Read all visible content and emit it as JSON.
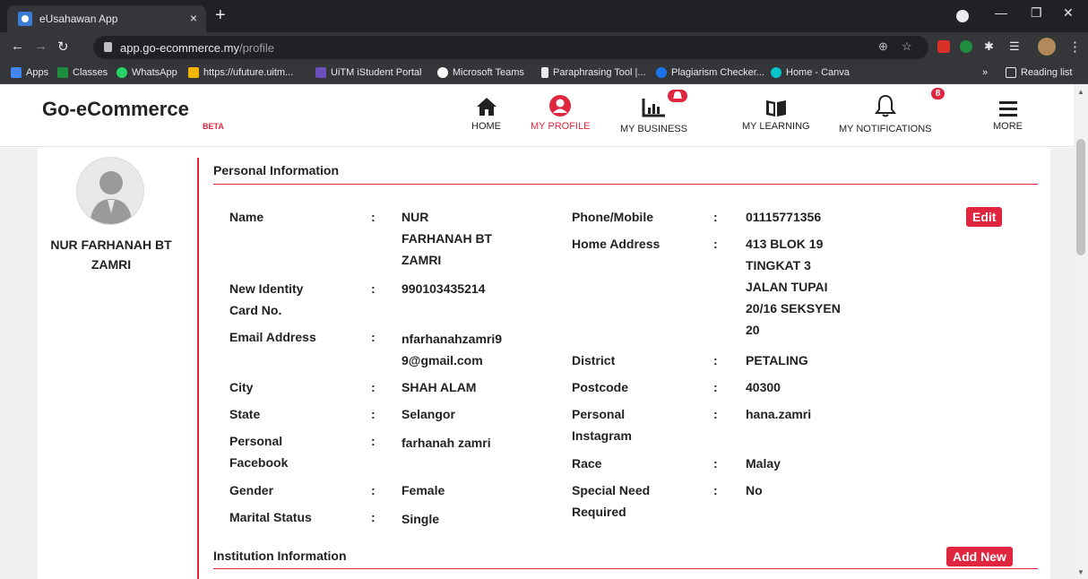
{
  "browser": {
    "tab_title": "eUsahawan App",
    "tab_close": "×",
    "new_tab": "+",
    "url_host": "app.go-ecommerce.my",
    "url_path": "/profile",
    "bookmarks": [
      {
        "label": "Apps",
        "color": "#4285f4"
      },
      {
        "label": "Classes",
        "color": "#1e8e3e"
      },
      {
        "label": "WhatsApp",
        "color": "#25d366"
      },
      {
        "label": "https://ufuture.uitm...",
        "color": "#f4b400"
      },
      {
        "label": "UiTM iStudent Portal",
        "color": "#6b4fbb"
      },
      {
        "label": "Microsoft Teams",
        "color": "#ffffff"
      },
      {
        "label": "Paraphrasing Tool |...",
        "color": "#ffffff"
      },
      {
        "label": "Plagiarism Checker...",
        "color": "#1a73e8"
      },
      {
        "label": "Home - Canva",
        "color": "#00c4cc"
      }
    ],
    "bookmarks_more": "»",
    "reading_list": "Reading list"
  },
  "header": {
    "logo": "Go-eCommerce",
    "beta": "BETA",
    "nav": [
      {
        "label": "HOME",
        "icon": "home-icon"
      },
      {
        "label": "MY PROFILE",
        "icon": "user-icon"
      },
      {
        "label": "MY BUSINESS",
        "icon": "chart-icon",
        "badge": ""
      },
      {
        "label": "MY LEARNING",
        "icon": "book-icon"
      },
      {
        "label": "MY NOTIFICATIONS",
        "icon": "bell-icon",
        "badge": "8"
      },
      {
        "label": "MORE",
        "icon": "menu-icon"
      }
    ],
    "accent_color": "#e0263f"
  },
  "profile": {
    "name_line1": "NUR FARHANAH BT",
    "name_line2": "ZAMRI"
  },
  "personal": {
    "title": "Personal Information",
    "edit_label": "Edit",
    "colon": ":",
    "left": {
      "name_label": "Name",
      "name_value": [
        "NUR",
        "FARHANAH BT",
        "ZAMRI"
      ],
      "ic_label": [
        "New Identity",
        "Card No."
      ],
      "ic_value": "990103435214",
      "email_label": "Email Address",
      "email_value": [
        "nfarhanahzamri9",
        "9@gmail.com"
      ],
      "city_label": "City",
      "city_value": "SHAH ALAM",
      "state_label": "State",
      "state_value": "Selangor",
      "fb_label": [
        "Personal",
        "Facebook"
      ],
      "fb_value": "farhanah zamri",
      "gender_label": "Gender",
      "gender_value": "Female",
      "marital_label": "Marital Status",
      "marital_value": "Single"
    },
    "right": {
      "phone_label": "Phone/Mobile",
      "phone_value": "01115771356",
      "address_label": "Home Address",
      "address_value": [
        "413 BLOK 19",
        "TINGKAT 3",
        "JALAN TUPAI",
        "20/16 SEKSYEN",
        "20"
      ],
      "district_label": "District",
      "district_value": "PETALING",
      "postcode_label": "Postcode",
      "postcode_value": "40300",
      "ig_label": [
        "Personal",
        "Instagram"
      ],
      "ig_value": "hana.zamri",
      "race_label": "Race",
      "race_value": "Malay",
      "special_label": [
        "Special Need",
        "Required"
      ],
      "special_value": "No"
    }
  },
  "institution": {
    "title": "Institution Information",
    "add_label": "Add New"
  }
}
